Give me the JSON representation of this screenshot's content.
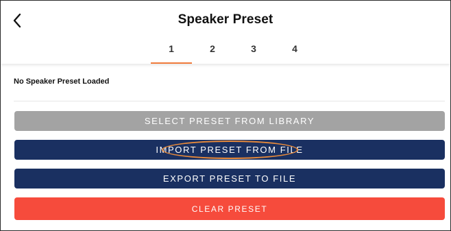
{
  "header": {
    "title": "Speaker Preset",
    "back_icon": "chevron-left-icon"
  },
  "tabs": [
    {
      "label": "1",
      "active": true
    },
    {
      "label": "2",
      "active": false
    },
    {
      "label": "3",
      "active": false
    },
    {
      "label": "4",
      "active": false
    }
  ],
  "status": {
    "text": "No Speaker Preset Loaded"
  },
  "buttons": {
    "select_label": "SELECT PRESET FROM LIBRARY",
    "import_label": "IMPORT PRESET FROM FILE",
    "export_label": "EXPORT PRESET TO FILE",
    "clear_label": "CLEAR PRESET"
  },
  "colors": {
    "accent": "#f07a3a",
    "select_bg": "#a3a3a3",
    "import_bg": "#1a3061",
    "export_bg": "#1a3061",
    "clear_bg": "#f64b3c",
    "highlight": "#e88a3a"
  }
}
